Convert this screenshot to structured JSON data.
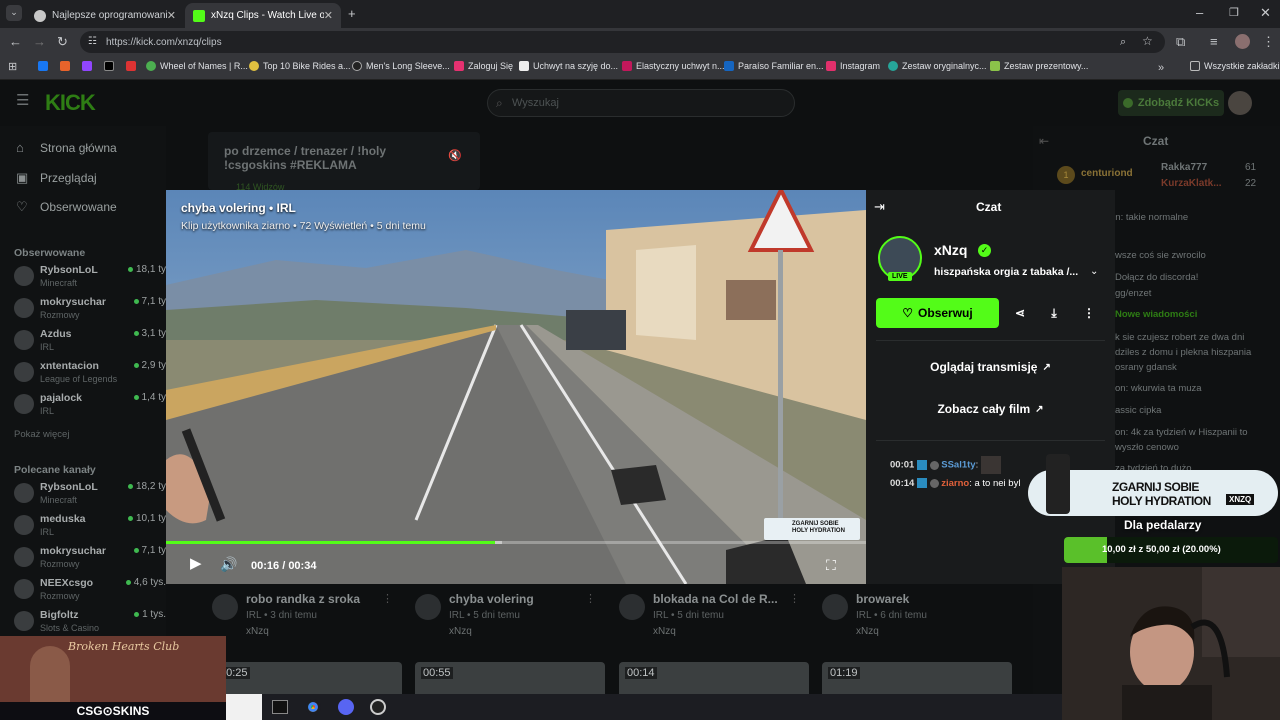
{
  "browser": {
    "tabs": [
      {
        "title": "Najlepsze oprogramowanie do"
      },
      {
        "title": "xNzq Clips - Watch Live on Kick"
      }
    ],
    "url": "https://kick.com/xnzq/clips",
    "bookmarks": [
      "Wheel of Names | R...",
      "Top 10 Bike Rides a...",
      "Men's Long Sleeve...",
      "Zaloguj Się",
      "Uchwyt na szyję do...",
      "Elastyczny uchwyt n...",
      "Paraíso Familiar en...",
      "Instagram",
      "Zestaw oryginalnyc...",
      "Zestaw prezentowy..."
    ],
    "all_bookmarks": "Wszystkie zakładki"
  },
  "site": {
    "logo": "KICK",
    "search_placeholder": "Wyszukaj",
    "get_kicks": "Zdobądź KICKs",
    "nav": [
      "Strona główna",
      "Przeglądaj",
      "Obserwowane"
    ],
    "followed_title": "Obserwowane",
    "followed": [
      {
        "name": "RybsonLoL",
        "cat": "Minecraft",
        "viewers": "18,1 ty"
      },
      {
        "name": "mokrysuchar",
        "cat": "Rozmowy",
        "viewers": "7,1 ty"
      },
      {
        "name": "Azdus",
        "cat": "IRL",
        "viewers": "3,1 ty"
      },
      {
        "name": "xntentacion",
        "cat": "League of Legends",
        "viewers": "2,9 ty"
      },
      {
        "name": "pajalock",
        "cat": "IRL",
        "viewers": "1,4 ty"
      }
    ],
    "show_more": "Pokaż więcej",
    "recommended_title": "Polecane kanały",
    "recommended": [
      {
        "name": "RybsonLoL",
        "cat": "Minecraft",
        "viewers": "18,2 ty"
      },
      {
        "name": "meduska",
        "cat": "IRL",
        "viewers": "10,1 ty"
      },
      {
        "name": "mokrysuchar",
        "cat": "Rozmowy",
        "viewers": "7,1 ty"
      },
      {
        "name": "NEEXcsgo",
        "cat": "Rozmowy",
        "viewers": "4,6 tys."
      },
      {
        "name": "Bigfoltz",
        "cat": "Slots & Casino",
        "viewers": "1 tys."
      }
    ],
    "bg_clip_title": "po drzemce / trenazer / !holy !csgoskins #REKLAMA",
    "bg_clip_views": "114 Widzów"
  },
  "modal": {
    "title": "chyba volering • IRL",
    "subtitle": "Klip użytkownika ziarno • 72 Wyświetleń • 5 dni temu",
    "time_current": "00:16",
    "time_total": "00:34",
    "progress": 0.47,
    "buffered": 0.48,
    "promo_text_1": "ZGARNIJ SOBIE",
    "promo_text_2": "HOLY HYDRATION",
    "chat_header": "Czat",
    "streamer": "xNzq",
    "live_badge": "LIVE",
    "stream_title": "hiszpańska orgia z tabaka /...",
    "follow_label": "Obserwuj",
    "watch_stream": "Oglądaj transmisję",
    "watch_full": "Zobacz cały film",
    "chat": [
      {
        "time": "00:01",
        "user": "SSal1ty",
        "text": ""
      },
      {
        "time": "00:14",
        "user": "ziarno",
        "text": "a to nei byl"
      }
    ]
  },
  "right_chat": {
    "header": "Czat",
    "top_users": [
      {
        "name": "centuriond",
        "rank": "1"
      },
      {
        "name": "Rakka777",
        "count": "61"
      },
      {
        "name": "KurzaKlatk...",
        "count": "22"
      }
    ],
    "lines": [
      "on: takie normalne",
      "wsze coś sie zwrocilo",
      "Dołącz do discorda!",
      "gg/enzet",
      "Nowe wiadomości",
      "k sie czujesz robert ze dwa dni",
      "dziles z domu i plekna hiszpania",
      "osrany gdansk",
      "on: wkurwia ta muza",
      "assic cipka",
      "on: 4k za tydzień w Hiszpanii to",
      "wyszło cenowo",
      "za tydzień to dużo"
    ]
  },
  "overlay": {
    "promo_1": "ZGARNIJ SOBIE",
    "promo_2": "HOLY HYDRATION",
    "promo_brand": "XNZQ",
    "goal_label": "Dla pedalarzy",
    "goal_text": "10,00 zł z 50,00 zł (20.00%)",
    "goal_progress": 0.2,
    "csgo_brand": "CSG⊙SKINS",
    "club_text": "Broken Hearts Club"
  },
  "clips": [
    {
      "title": "robo randka z sroka",
      "meta": "IRL • 3 dni temu",
      "user": "xNzq",
      "duration": "00:25"
    },
    {
      "title": "chyba volering",
      "meta": "IRL • 5 dni temu",
      "user": "xNzq",
      "duration": "00:55"
    },
    {
      "title": "blokada na Col de R...",
      "meta": "IRL • 5 dni temu",
      "user": "xNzq",
      "duration": "00:14"
    },
    {
      "title": "browarek",
      "meta": "IRL • 6 dni temu",
      "user": "xNzq",
      "duration": "01:19"
    }
  ]
}
